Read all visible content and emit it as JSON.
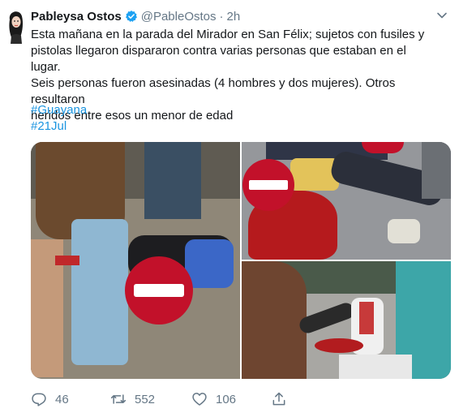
{
  "tweet": {
    "author_name": "Pableysa Ostos",
    "handle": "@PableOstos",
    "separator": "·",
    "time": "2h",
    "text": "Esta mañana en la parada del Mirador en San Félix; sujetos con fusiles y\npistolas llegaron dispararon contra varias personas que estaban en el lugar.\nSeis personas fueron asesinadas (4 hombres y dos mujeres). Otros resultaron\nheridos entre esos un menor de edad",
    "hashtags": [
      "#Guayana",
      "#21Jul"
    ]
  },
  "actions": {
    "replies": "46",
    "retweets": "552",
    "likes": "106"
  },
  "media": {
    "photo_count": 3,
    "overlay_icon": "no-entry-icon"
  },
  "colors": {
    "link": "#1b95e0",
    "secondary_text": "#657786",
    "verified": "#1da1f2",
    "no_entry": "#c2112a"
  },
  "icons": {
    "reply": "reply-icon",
    "retweet": "retweet-icon",
    "like": "heart-icon",
    "share": "share-icon",
    "menu": "chevron-down-icon",
    "verified": "verified-badge-icon"
  }
}
